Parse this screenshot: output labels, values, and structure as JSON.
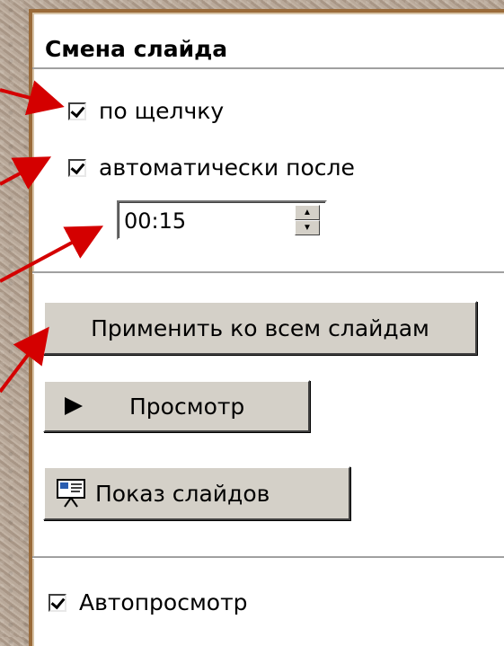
{
  "panel": {
    "section_title": "Смена слайда",
    "on_click": {
      "label": "по щелчку",
      "checked": true
    },
    "auto_after": {
      "label": "автоматически после",
      "checked": true
    },
    "time_value": "00:15",
    "apply_all_label": "Применить ко всем слайдам",
    "preview_label": "Просмотр",
    "slideshow_label": "Показ слайдов",
    "autopreview": {
      "label": "Автопросмотр",
      "checked": true
    }
  },
  "colors": {
    "arrow": "#d40000",
    "panel_border": "#9a6b3a",
    "button_face": "#d4d0c8"
  },
  "icons": [
    "checkbox-checked-icon",
    "spin-up-icon",
    "spin-down-icon",
    "play-triangle-icon",
    "slideshow-screen-icon"
  ]
}
